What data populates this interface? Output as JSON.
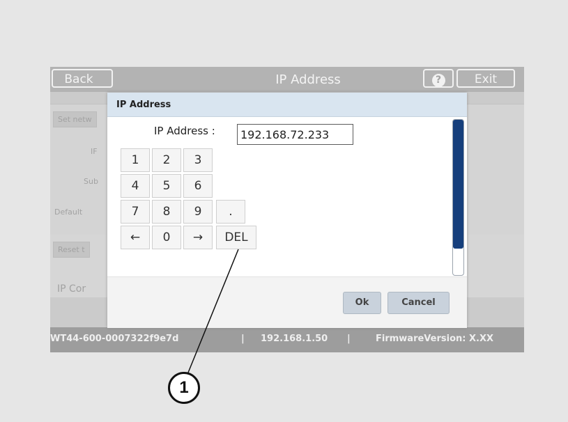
{
  "topbar": {
    "back_label": "Back",
    "title": "IP Address",
    "help_label": "?",
    "exit_label": "Exit"
  },
  "background": {
    "set_network_label": "Set netw",
    "ip_label": "IF",
    "subnet_label": "Sub",
    "default_label": "Default",
    "reset_label": "Reset t",
    "ip_config_label": "IP Cor"
  },
  "dialog": {
    "title": "IP Address",
    "ip_label": "IP Address :",
    "ip_value": "192.168.72.233",
    "keypad": [
      "1",
      "2",
      "3",
      "4",
      "5",
      "6",
      "7",
      "8",
      "9",
      ".",
      "←",
      "0",
      "→",
      "DEL"
    ],
    "ok_label": "Ok",
    "cancel_label": "Cancel"
  },
  "statusbar": {
    "device_id": "WT44-600-0007322f9e7d",
    "sep1": "|",
    "ip": "192.168.1.50",
    "sep2": "|",
    "firmware": "FirmwareVersion: X.XX"
  },
  "callout": {
    "number": "1"
  },
  "colors": {
    "titlebar": "#d9e5f0",
    "scrollbar": "#163f7c",
    "topbar": "#b3b3b3",
    "statusbar": "#9d9d9d"
  }
}
